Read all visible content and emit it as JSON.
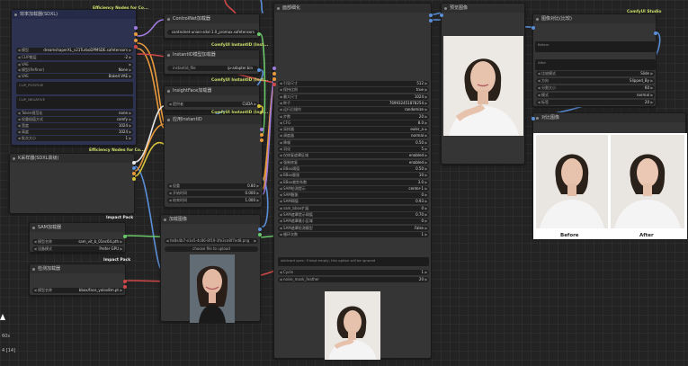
{
  "app": {
    "name": "ComfyUI"
  },
  "colors": {
    "canvas": "#232323",
    "node": "#353535",
    "node_blue": "#2d3250",
    "badge_green": "#cfe06a",
    "wire_orange": "#e89a3c",
    "wire_yellow": "#d8c23a",
    "wire_purple": "#a07be0",
    "wire_green": "#6ac86a",
    "wire_blue": "#5a8fd8",
    "wire_red": "#d04848",
    "wire_white": "#dddddd"
  },
  "nodes": {
    "loader": {
      "title": "效率加载器(SDXL)",
      "badge": "Efficiency Nodes for Co...",
      "widgets": [
        {
          "label": "模型",
          "value": "dreamshaperXL_v21TurboDPMSDE.safetensors"
        },
        {
          "label": "CLIP跳层",
          "value": "-2"
        },
        {
          "label": "VAE",
          "value": ""
        },
        {
          "label": "模型(Refiner)",
          "value": "None"
        },
        {
          "label": "VAE",
          "value": "Baked VAE"
        }
      ],
      "pos_label": "CLIP_POSITIVE",
      "neg_label": "CLIP_NEGATIVE",
      "widgets2": [
        {
          "label": "Token规范化",
          "value": "none"
        },
        {
          "label": "权重插值方式",
          "value": "comfy"
        },
        {
          "label": "宽度",
          "value": "1024"
        },
        {
          "label": "高度",
          "value": "1024"
        },
        {
          "label": "批次大小",
          "value": "1"
        }
      ]
    },
    "sampler": {
      "title": "K采样器(SDXL高级)",
      "badge": "Efficiency Nodes for Co..."
    },
    "controlnet": {
      "title": "ControlNet加载器",
      "widget_value": "controlnet-union-sdxl-1.0_promax.safetensors"
    },
    "instantid_loader": {
      "title": "InstantID模型加载器",
      "badge": "ComfyUI InstantID (Inst...",
      "widget_label": "instantid_file",
      "widget_value": "ip-adapter.bin"
    },
    "insightface": {
      "title": "InsightFace加载器",
      "badge": "ComfyUI InstantID (Inst...",
      "widget_label": "提供者",
      "widget_value": "CUDA"
    },
    "apply_instantid": {
      "title": "应用InstantID",
      "widgets": [
        {
          "label": "权重",
          "value": "0.80"
        },
        {
          "label": "开始时间",
          "value": "0.000"
        },
        {
          "label": "结束时间",
          "value": "1.000"
        }
      ]
    },
    "sam_loader": {
      "title": "SAM加载器",
      "badge": "Impact Pack",
      "widgets": [
        {
          "label": "模型名称",
          "value": "sam_vit_b_01ec64.pth"
        },
        {
          "label": "设备模式",
          "value": "Prefer GPU"
        }
      ]
    },
    "bbox_loader": {
      "title": "检测加载器",
      "badge": "Impact Pack",
      "widgets": [
        {
          "label": "模型名称",
          "value": "bbox/face_yolov8m.pt"
        }
      ]
    },
    "load_image": {
      "title": "加载图像",
      "widget_value": "hk8s4b7-e1e5-4c86-8f19-3fe3ce8f7ed8.png",
      "upload_label": "choose file to upload"
    },
    "face_detailer": {
      "title": "面部细化",
      "widgets": [
        {
          "label": "引导尺寸",
          "value": "512"
        },
        {
          "label": "保持比例",
          "value": "true"
        },
        {
          "label": "最大尺寸",
          "value": "1024"
        },
        {
          "label": "种子",
          "value": "769932451878254"
        },
        {
          "label": "运行后操作",
          "value": "randomize"
        },
        {
          "label": "步数",
          "value": "20"
        },
        {
          "label": "CFG",
          "value": "8.0"
        },
        {
          "label": "采样器",
          "value": "euler_a"
        },
        {
          "label": "调度器",
          "value": "normal"
        },
        {
          "label": "降噪",
          "value": "0.50"
        },
        {
          "label": "羽化",
          "value": "5"
        },
        {
          "label": "仅修复遮罩区域",
          "value": "enabled"
        },
        {
          "label": "强制修复",
          "value": "enabled"
        },
        {
          "label": "BBox阈值",
          "value": "0.50"
        },
        {
          "label": "BBox膨胀",
          "value": "10"
        },
        {
          "label": "BBox裁剪系数",
          "value": "3.0"
        },
        {
          "label": "SAM检测提示",
          "value": "center-1"
        },
        {
          "label": "SAM膨胀",
          "value": "0"
        },
        {
          "label": "SAM阈值",
          "value": "0.93"
        },
        {
          "label": "sam_bbox扩展",
          "value": "0"
        },
        {
          "label": "SAM遮罩提示阈值",
          "value": "0.70"
        },
        {
          "label": "SAM遮罩最小区域",
          "value": "0"
        },
        {
          "label": "SAM遮罩检测模型",
          "value": "False"
        },
        {
          "label": "循环次数",
          "value": "1"
        }
      ],
      "wildcard_placeholder": "wildcard spec: if kept empty, this option will be ignored",
      "widgets2": [
        {
          "label": "Cycle",
          "value": "1"
        },
        {
          "label": "noise_mask_feather",
          "value": "20"
        }
      ]
    },
    "preview": {
      "title": "预览图像"
    },
    "compare": {
      "title": "图像对比(比较)",
      "badge": "ComfyUI Studio",
      "a_label": "Before",
      "b_label": "After",
      "widgets": [
        {
          "label": "比较模式",
          "value": "Slide"
        },
        {
          "label": "方向",
          "value": "Slipped_By"
        },
        {
          "label": "分割大小",
          "value": "60"
        },
        {
          "label": "模式",
          "value": "normal"
        },
        {
          "label": "标签",
          "value": "20"
        }
      ]
    },
    "compare_preview": {
      "title": "对比图像",
      "before_label": "Before",
      "after_label": "After"
    }
  },
  "side_text": [
    "60s",
    "4 [14]"
  ]
}
